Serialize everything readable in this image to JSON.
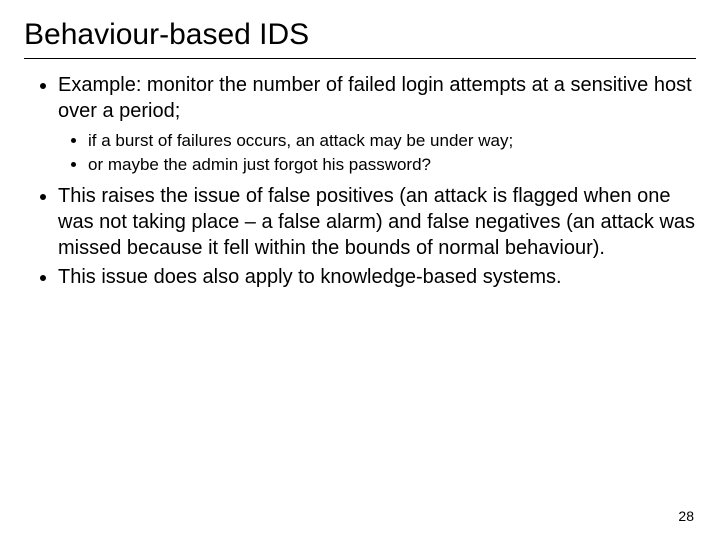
{
  "slide": {
    "title": "Behaviour-based IDS",
    "bullets": [
      {
        "text": "Example: monitor the number of failed login attempts at a sensitive host over a period;",
        "sub": [
          "if a burst of failures occurs, an attack may be under way;",
          "or maybe the admin just forgot his password?"
        ]
      },
      {
        "text": "This raises the issue of false positives (an attack is flagged when one was not taking place – a false alarm) and false negatives (an attack was missed because it fell within the bounds of normal behaviour).",
        "sub": []
      },
      {
        "text": "This issue does also apply to knowledge-based systems.",
        "sub": []
      }
    ],
    "page_number": "28"
  }
}
